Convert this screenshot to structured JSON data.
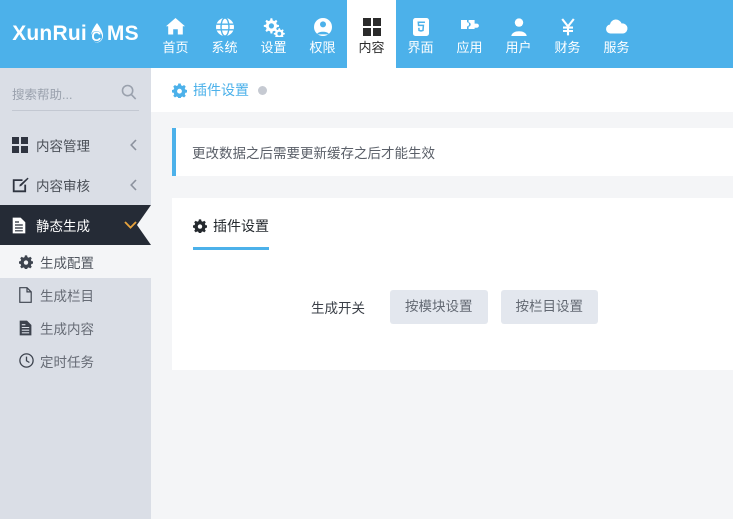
{
  "brand": {
    "text_before": "XunRui",
    "logo_icon": "flame-droplet-icon",
    "text_after": "MS",
    "letter_in_drop": "C"
  },
  "topnav": {
    "items": [
      {
        "label": "首页",
        "icon": "home-icon",
        "active": false
      },
      {
        "label": "系统",
        "icon": "globe-icon",
        "active": false
      },
      {
        "label": "设置",
        "icon": "gears-icon",
        "active": false
      },
      {
        "label": "权限",
        "icon": "user-circle-icon",
        "active": false
      },
      {
        "label": "内容",
        "icon": "grid-icon",
        "active": true
      },
      {
        "label": "界面",
        "icon": "html5-icon",
        "active": false
      },
      {
        "label": "应用",
        "icon": "puzzle-icon",
        "active": false
      },
      {
        "label": "用户",
        "icon": "user-icon",
        "active": false
      },
      {
        "label": "财务",
        "icon": "yen-icon",
        "active": false
      },
      {
        "label": "服务",
        "icon": "cloud-icon",
        "active": false
      }
    ]
  },
  "sidebar": {
    "search": {
      "placeholder": "搜索帮助...",
      "value": "",
      "icon": "search-icon"
    },
    "items": [
      {
        "label": "内容管理",
        "icon": "grid-icon",
        "chevron": "chevron-left-icon",
        "active": false
      },
      {
        "label": "内容审核",
        "icon": "edit-square-icon",
        "chevron": "chevron-left-icon",
        "active": false
      },
      {
        "label": "静态生成",
        "icon": "file-text-icon",
        "chevron": "chevron-down-icon",
        "active": true
      }
    ],
    "subitems": [
      {
        "label": "生成配置",
        "icon": "gear-icon",
        "active": true
      },
      {
        "label": "生成栏目",
        "icon": "file-o-icon",
        "active": false
      },
      {
        "label": "生成内容",
        "icon": "file-text-icon",
        "active": false
      },
      {
        "label": "定时任务",
        "icon": "clock-icon",
        "active": false
      }
    ]
  },
  "breadcrumb": {
    "icon": "gear-icon",
    "title": "插件设置",
    "dot": "status-dot"
  },
  "alert": {
    "message": "更改数据之后需要更新缓存之后才能生效"
  },
  "content": {
    "tab": {
      "icon": "gear-icon",
      "label": "插件设置"
    },
    "form": {
      "label": "生成开关",
      "buttons": [
        {
          "label": "按模块设置"
        },
        {
          "label": "按栏目设置"
        }
      ]
    }
  },
  "colors": {
    "nav_blue": "#4cb1ea",
    "sidebar_bg": "#dadee6",
    "sidebar_active_bg": "#252b36",
    "main_bg": "#f4f5f7",
    "card_bg": "#ffffff",
    "button_bg": "#e3e7ee",
    "accent": "#4cb1ea",
    "chevron_gold": "#e8a33d"
  }
}
